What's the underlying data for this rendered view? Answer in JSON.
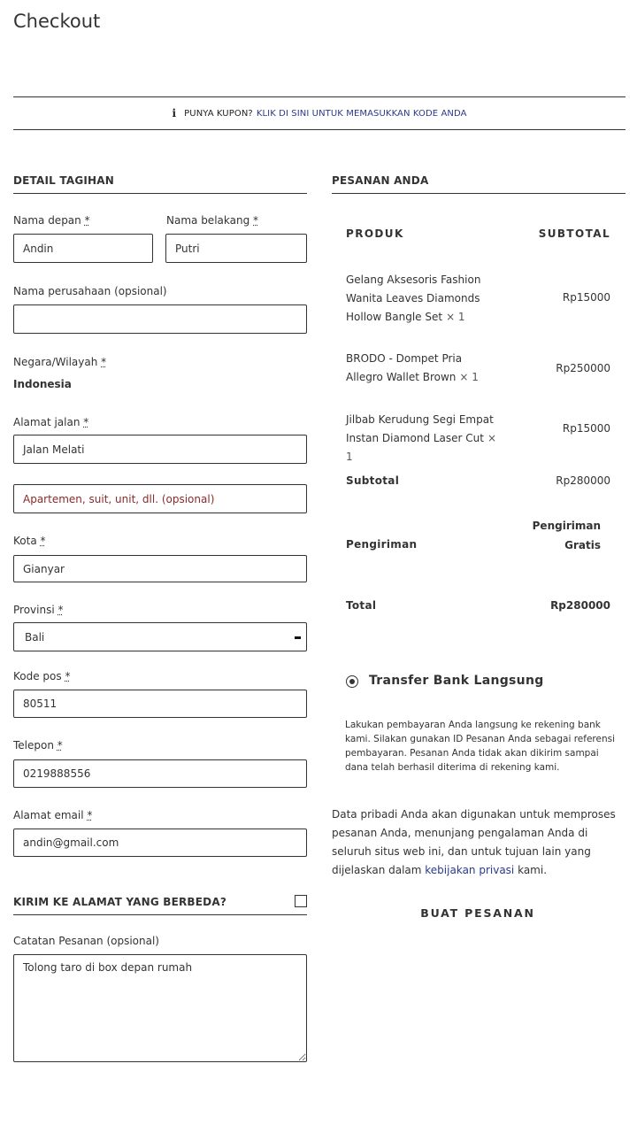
{
  "page": {
    "title": "Checkout"
  },
  "coupon": {
    "question": "PUNYA KUPON?",
    "link": "KLIK DI SINI UNTUK MEMASUKKAN KODE ANDA"
  },
  "billing": {
    "heading": "DETAIL TAGIHAN",
    "first_name": {
      "label": "Nama depan",
      "value": "Andin"
    },
    "last_name": {
      "label": "Nama belakang",
      "value": "Putri"
    },
    "company": {
      "label": "Nama perusahaan (opsional)",
      "value": ""
    },
    "country": {
      "label": "Negara/Wilayah",
      "value": "Indonesia"
    },
    "street": {
      "label": "Alamat jalan",
      "value": "Jalan Melati"
    },
    "apartment": {
      "placeholder": "Apartemen, suit, unit, dll. (opsional)"
    },
    "city": {
      "label": "Kota",
      "value": "Gianyar"
    },
    "province": {
      "label": "Provinsi",
      "value": "Bali"
    },
    "postcode": {
      "label": "Kode pos",
      "value": "80511"
    },
    "phone": {
      "label": "Telepon",
      "value": "0219888556"
    },
    "email": {
      "label": "Alamat email",
      "value": "andin@gmail.com"
    },
    "required_mark": "*"
  },
  "shipping_different": {
    "label": "KIRIM KE ALAMAT YANG BERBEDA?",
    "checked": false
  },
  "notes": {
    "label": "Catatan Pesanan (opsional)",
    "value": "Tolong taro di box depan rumah"
  },
  "order": {
    "heading": "PESANAN ANDA",
    "col_product": "PRODUK",
    "col_subtotal": "SUBTOTAL",
    "items": [
      {
        "name": "Gelang Aksesoris Fashion Wanita Leaves Diamonds Hollow Bangle Set",
        "qty": "× 1",
        "price": "Rp15000"
      },
      {
        "name": "BRODO - Dompet Pria Allegro Wallet Brown",
        "qty": "× 1",
        "price": "Rp250000"
      },
      {
        "name": "Jilbab Kerudung Segi Empat Instan Diamond Laser Cut",
        "qty": "× 1",
        "price": "Rp15000"
      }
    ],
    "subtotal_label": "Subtotal",
    "subtotal_value": "Rp280000",
    "shipping_label": "Pengiriman",
    "shipping_value": "Pengiriman Gratis",
    "total_label": "Total",
    "total_value": "Rp280000"
  },
  "payment": {
    "method": "Transfer Bank Langsung",
    "description": "Lakukan pembayaran Anda langsung ke rekening bank kami. Silakan gunakan ID Pesanan Anda sebagai referensi pembayaran. Pesanan Anda tidak akan dikirim sampai dana telah berhasil diterima di rekening kami."
  },
  "privacy": {
    "text_before": "Data pribadi Anda akan digunakan untuk memproses pesanan Anda, menunjang pengalaman Anda di seluruh situs web ini, dan untuk tujuan lain yang dijelaskan dalam ",
    "link": "kebijakan privasi",
    "text_after": " kami."
  },
  "place_order": {
    "label": "BUAT PESANAN"
  }
}
